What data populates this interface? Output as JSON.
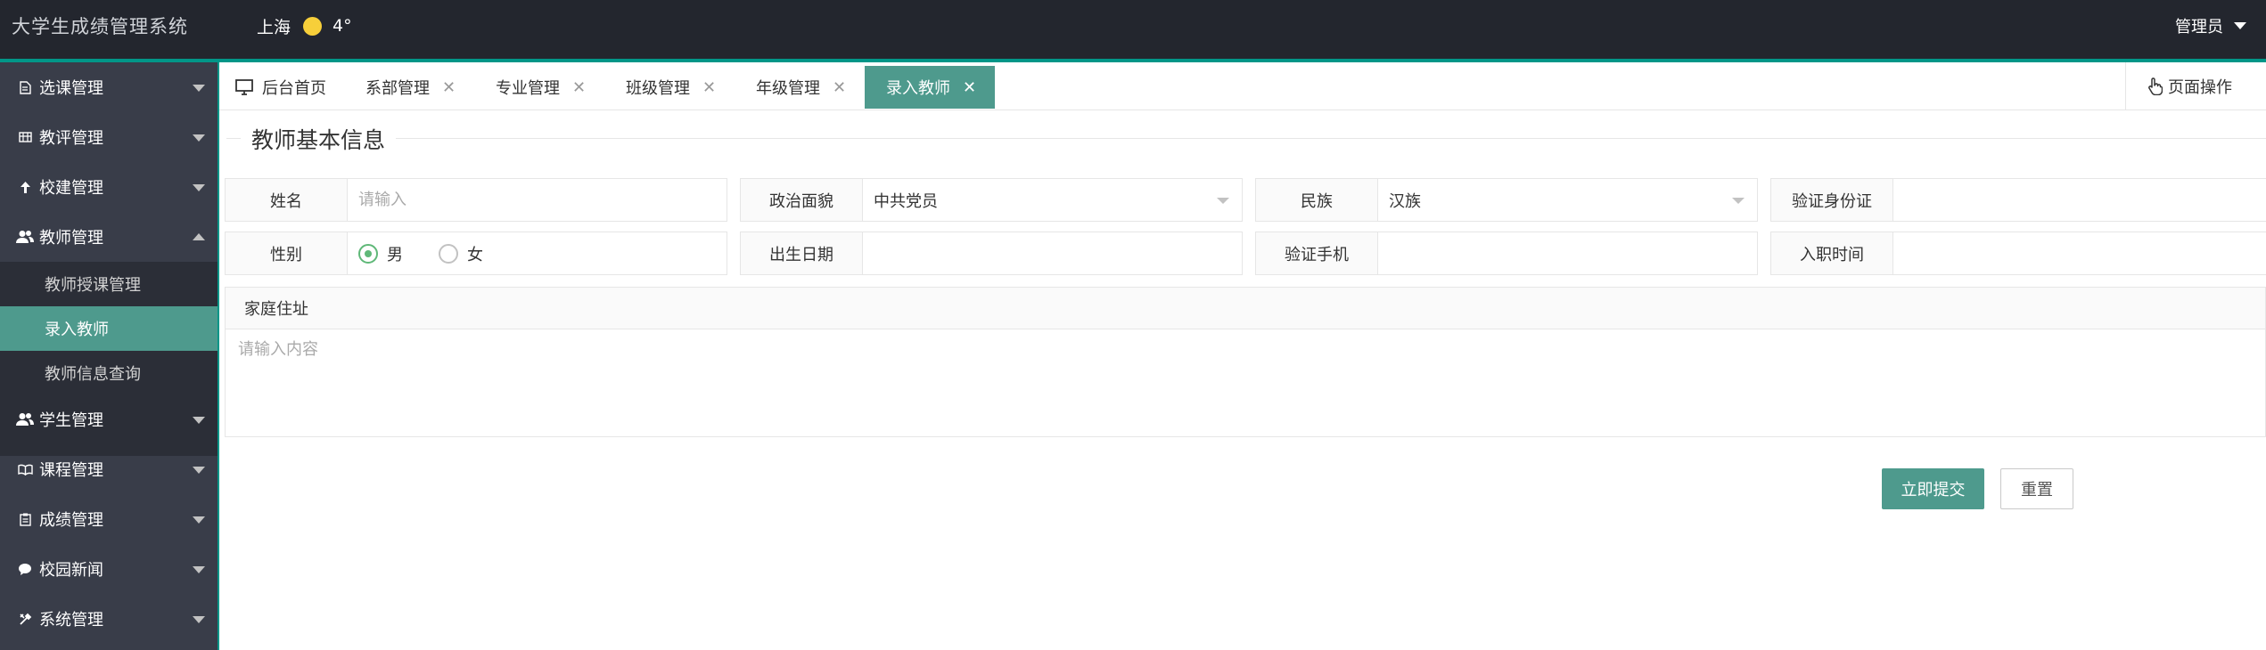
{
  "header": {
    "app_title": "大学生成绩管理系统",
    "city": "上海",
    "temperature": "4°",
    "user": "管理员"
  },
  "sidebar": {
    "items": [
      {
        "label": "选课管理",
        "icon": "document-icon"
      },
      {
        "label": "教评管理",
        "icon": "table-icon"
      },
      {
        "label": "校建管理",
        "icon": "tree-icon"
      },
      {
        "label": "教师管理",
        "icon": "users-icon",
        "expanded": true
      },
      {
        "label": "学生管理",
        "icon": "users-icon"
      },
      {
        "label": "课程管理",
        "icon": "book-icon"
      },
      {
        "label": "成绩管理",
        "icon": "clipboard-icon"
      },
      {
        "label": "校园新闻",
        "icon": "chat-icon"
      },
      {
        "label": "系统管理",
        "icon": "tools-icon"
      }
    ],
    "sub_items": [
      {
        "label": "教师授课管理"
      },
      {
        "label": "录入教师",
        "active": true
      },
      {
        "label": "教师信息查询"
      }
    ]
  },
  "tabs": [
    {
      "label": "后台首页",
      "icon": "monitor-icon"
    },
    {
      "label": "系部管理"
    },
    {
      "label": "专业管理"
    },
    {
      "label": "班级管理"
    },
    {
      "label": "年级管理"
    },
    {
      "label": "录入教师",
      "active": true
    }
  ],
  "page_ops": {
    "label": "页面操作",
    "icon": "hand-pointer-icon"
  },
  "form": {
    "legend": "教师基本信息",
    "name_label": "姓名",
    "name_placeholder": "请输入",
    "politics_label": "政治面貌",
    "politics_value": "中共党员",
    "ethnicity_label": "民族",
    "ethnicity_value": "汉族",
    "id_label": "验证身份证",
    "gender_label": "性别",
    "gender_male": "男",
    "gender_female": "女",
    "gender_selected": "男",
    "birth_label": "出生日期",
    "phone_label": "验证手机",
    "hire_label": "入职时间",
    "address_label": "家庭住址",
    "address_placeholder": "请输入内容",
    "submit_label": "立即提交",
    "reset_label": "重置"
  },
  "colors": {
    "header_bg": "#23262e",
    "sidebar_bg": "#393d49",
    "accent": "#009688",
    "active_tab": "#4e9a8d",
    "radio_checked": "#5fb878",
    "sun": "#f7cf3a"
  }
}
